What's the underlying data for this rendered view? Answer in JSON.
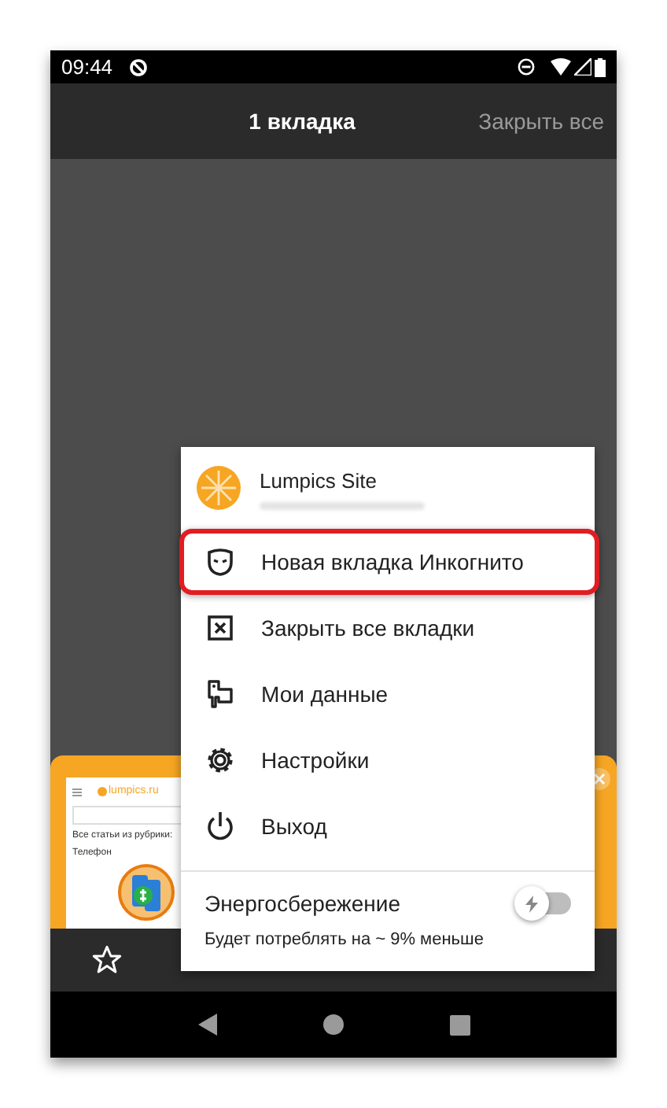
{
  "status_bar": {
    "time": "09:44"
  },
  "top_bar": {
    "title": "1 вкладка",
    "close_all": "Закрыть все"
  },
  "tab_card": {
    "site": "lumpics.ru",
    "heading": "Все статьи из рубрики:",
    "subheading": "Телефон"
  },
  "menu": {
    "profile": {
      "name": "Lumpics Site"
    },
    "items": [
      {
        "kind": "incognito",
        "label": "Новая вкладка Инкогнито",
        "highlighted": true
      },
      {
        "kind": "close",
        "label": "Закрыть все вкладки",
        "highlighted": false
      },
      {
        "kind": "data",
        "label": "Мои данные",
        "highlighted": false
      },
      {
        "kind": "settings",
        "label": "Настройки",
        "highlighted": false
      },
      {
        "kind": "exit",
        "label": "Выход",
        "highlighted": false
      }
    ],
    "power_saving": {
      "title": "Энергосбережение",
      "subtitle": "Будет потреблять на ~ 9% меньше",
      "on": false
    }
  }
}
